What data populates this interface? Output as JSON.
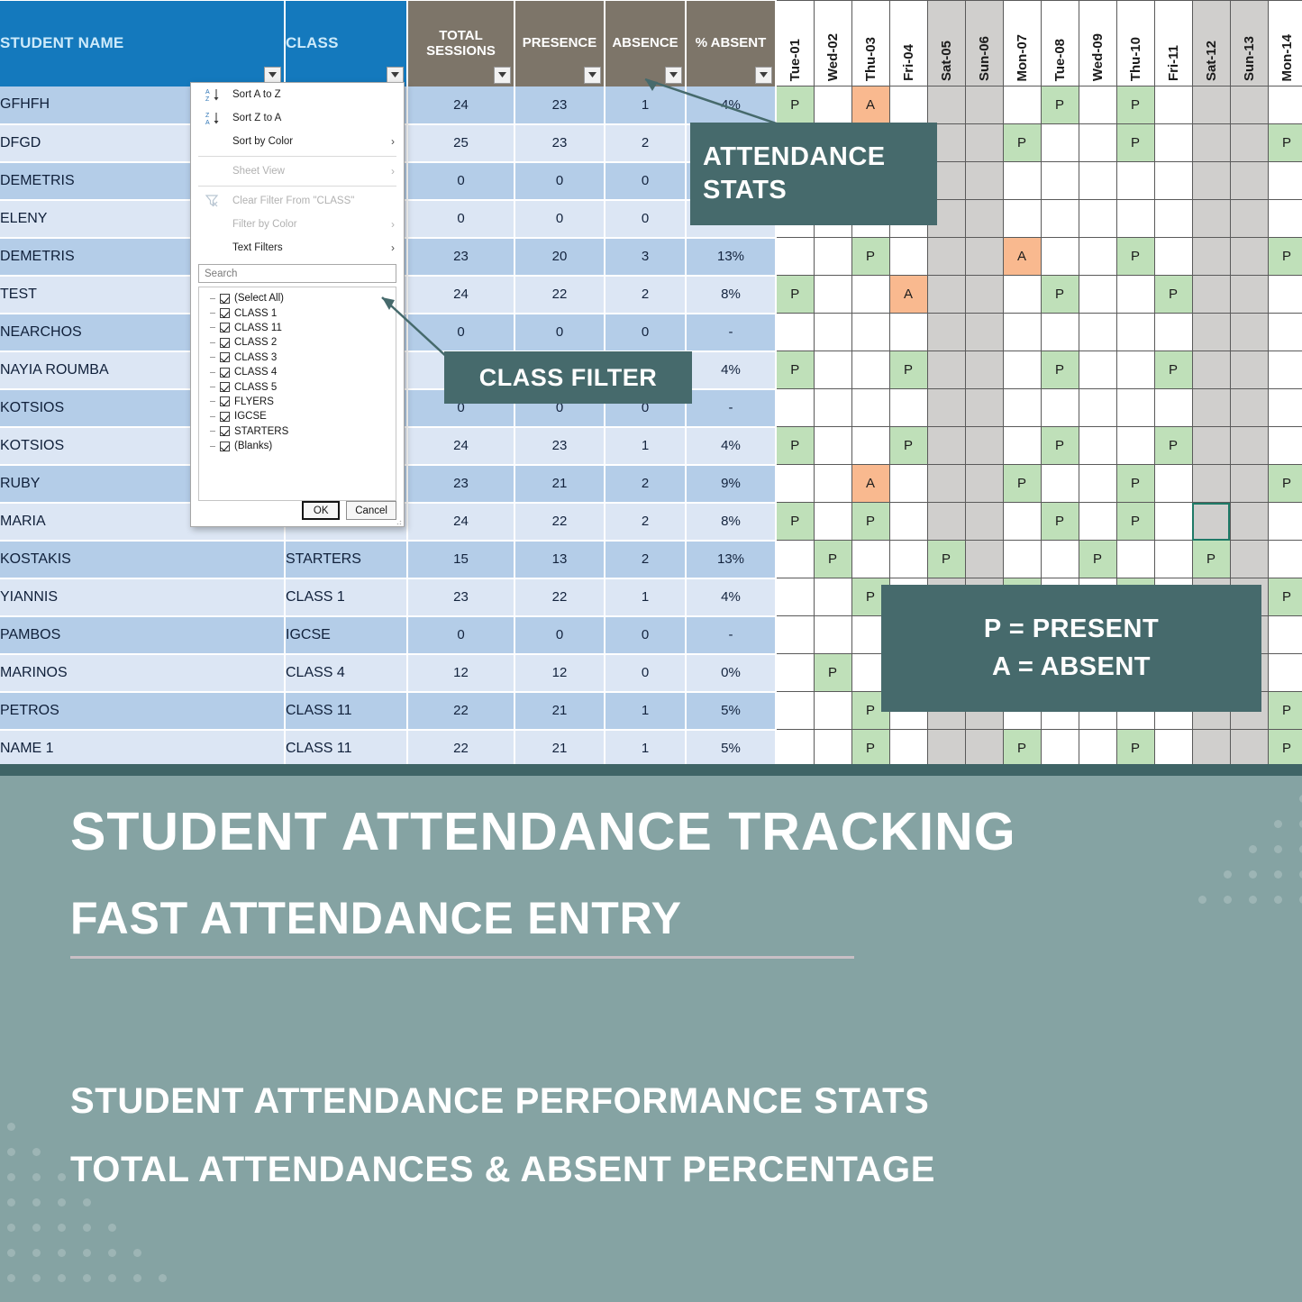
{
  "sheet": {
    "columns": {
      "student_name": "STUDENT NAME",
      "class": "CLASS",
      "total_sessions": "TOTAL SESSIONS",
      "total_sessions_l1": "TOTAL",
      "total_sessions_l2": "SESSIONS",
      "presence": "PRESENCE",
      "absence": "ABSENCE",
      "percent_absent": "% ABSENT"
    },
    "date_columns": [
      {
        "label": "Tue-01",
        "weekend": false
      },
      {
        "label": "Wed-02",
        "weekend": false
      },
      {
        "label": "Thu-03",
        "weekend": false
      },
      {
        "label": "Fri-04",
        "weekend": false
      },
      {
        "label": "Sat-05",
        "weekend": true
      },
      {
        "label": "Sun-06",
        "weekend": true
      },
      {
        "label": "Mon-07",
        "weekend": false
      },
      {
        "label": "Tue-08",
        "weekend": false
      },
      {
        "label": "Wed-09",
        "weekend": false
      },
      {
        "label": "Thu-10",
        "weekend": false
      },
      {
        "label": "Fri-11",
        "weekend": false
      },
      {
        "label": "Sat-12",
        "weekend": true
      },
      {
        "label": "Sun-13",
        "weekend": true
      },
      {
        "label": "Mon-14",
        "weekend": false
      }
    ],
    "rows": [
      {
        "name": "GFHFH",
        "class": "",
        "total": "24",
        "presence": "23",
        "absence": "1",
        "pct": "4%",
        "att": [
          "P",
          "",
          "A",
          "",
          "",
          "",
          "",
          "P",
          "",
          "P",
          "",
          "",
          "",
          ""
        ]
      },
      {
        "name": "DFGD",
        "class": "",
        "total": "25",
        "presence": "23",
        "absence": "2",
        "pct": "",
        "att": [
          "",
          "",
          "",
          "",
          "",
          "",
          "P",
          "",
          "",
          "P",
          "",
          "",
          "",
          "P"
        ]
      },
      {
        "name": "DEMETRIS",
        "class": "",
        "total": "0",
        "presence": "0",
        "absence": "0",
        "pct": "",
        "att": [
          "",
          "",
          "",
          "",
          "",
          "",
          "",
          "",
          "",
          "",
          "",
          "",
          "",
          ""
        ]
      },
      {
        "name": "ELENY",
        "class": "",
        "total": "0",
        "presence": "0",
        "absence": "0",
        "pct": "",
        "att": [
          "",
          "",
          "",
          "",
          "",
          "",
          "",
          "",
          "",
          "",
          "",
          "",
          "",
          ""
        ]
      },
      {
        "name": "DEMETRIS",
        "class": "",
        "total": "23",
        "presence": "20",
        "absence": "3",
        "pct": "13%",
        "att": [
          "",
          "",
          "P",
          "",
          "",
          "",
          "A",
          "",
          "",
          "P",
          "",
          "",
          "",
          "P"
        ]
      },
      {
        "name": "TEST",
        "class": "",
        "total": "24",
        "presence": "22",
        "absence": "2",
        "pct": "8%",
        "att": [
          "P",
          "",
          "",
          "A",
          "",
          "",
          "",
          "P",
          "",
          "",
          "P",
          "",
          "",
          ""
        ]
      },
      {
        "name": "NEARCHOS",
        "class": "",
        "total": "0",
        "presence": "0",
        "absence": "0",
        "pct": "-",
        "att": [
          "",
          "",
          "",
          "",
          "",
          "",
          "",
          "",
          "",
          "",
          "",
          "",
          "",
          ""
        ]
      },
      {
        "name": "NAYIA ROUMBA",
        "class": "",
        "total": "",
        "presence": "",
        "absence": "",
        "pct": "4%",
        "att": [
          "P",
          "",
          "",
          "P",
          "",
          "",
          "",
          "P",
          "",
          "",
          "P",
          "",
          "",
          ""
        ]
      },
      {
        "name": "KOTSIOS",
        "class": "",
        "total": "0",
        "presence": "0",
        "absence": "0",
        "pct": "-",
        "att": [
          "",
          "",
          "",
          "",
          "",
          "",
          "",
          "",
          "",
          "",
          "",
          "",
          "",
          ""
        ]
      },
      {
        "name": "KOTSIOS",
        "class": "",
        "total": "24",
        "presence": "23",
        "absence": "1",
        "pct": "4%",
        "att": [
          "P",
          "",
          "",
          "P",
          "",
          "",
          "",
          "P",
          "",
          "",
          "P",
          "",
          "",
          ""
        ]
      },
      {
        "name": "RUBY",
        "class": "",
        "total": "23",
        "presence": "21",
        "absence": "2",
        "pct": "9%",
        "att": [
          "",
          "",
          "A",
          "",
          "",
          "",
          "P",
          "",
          "",
          "P",
          "",
          "",
          "",
          "P"
        ]
      },
      {
        "name": "MARIA",
        "class": "",
        "total": "24",
        "presence": "22",
        "absence": "2",
        "pct": "8%",
        "att": [
          "P",
          "",
          "P",
          "",
          "",
          "",
          "",
          "P",
          "",
          "P",
          "",
          "SEL",
          "",
          ""
        ]
      },
      {
        "name": "KOSTAKIS",
        "class": "STARTERS",
        "total": "15",
        "presence": "13",
        "absence": "2",
        "pct": "13%",
        "att": [
          "",
          "P",
          "",
          "",
          "P",
          "",
          "",
          "",
          "P",
          "",
          "",
          "P",
          "",
          ""
        ]
      },
      {
        "name": "YIANNIS",
        "class": "CLASS 1",
        "total": "23",
        "presence": "22",
        "absence": "1",
        "pct": "4%",
        "att": [
          "",
          "",
          "P",
          "",
          "",
          "",
          "P",
          "",
          "",
          "P",
          "",
          "",
          "",
          "P"
        ]
      },
      {
        "name": "PAMBOS",
        "class": "IGCSE",
        "total": "0",
        "presence": "0",
        "absence": "0",
        "pct": "-",
        "att": [
          "",
          "",
          "",
          "",
          "",
          "",
          "",
          "",
          "",
          "",
          "",
          "",
          "",
          ""
        ]
      },
      {
        "name": "MARINOS",
        "class": "CLASS 4",
        "total": "12",
        "presence": "12",
        "absence": "0",
        "pct": "0%",
        "att": [
          "",
          "P",
          "",
          "",
          "",
          "",
          "",
          "",
          "",
          "",
          "",
          "",
          "",
          ""
        ]
      },
      {
        "name": "PETROS",
        "class": "CLASS 11",
        "total": "22",
        "presence": "21",
        "absence": "1",
        "pct": "5%",
        "att": [
          "",
          "",
          "P",
          "",
          "",
          "",
          "",
          "",
          "",
          "",
          "",
          "",
          "",
          "P"
        ]
      },
      {
        "name": "NAME 1",
        "class": "CLASS 11",
        "total": "22",
        "presence": "21",
        "absence": "1",
        "pct": "5%",
        "att": [
          "",
          "",
          "P",
          "",
          "",
          "",
          "P",
          "",
          "",
          "P",
          "",
          "",
          "",
          "P"
        ]
      }
    ]
  },
  "filter_menu": {
    "sort_a_z": "Sort A to Z",
    "sort_z_a": "Sort Z to A",
    "sort_by_color": "Sort by Color",
    "sheet_view": "Sheet View",
    "clear_filter": "Clear Filter From \"CLASS\"",
    "filter_by_color": "Filter by Color",
    "text_filters": "Text Filters",
    "search_placeholder": "Search",
    "options": [
      "(Select All)",
      "CLASS 1",
      "CLASS 11",
      "CLASS 2",
      "CLASS 3",
      "CLASS 4",
      "CLASS 5",
      "FLYERS",
      "IGCSE",
      "STARTERS",
      "(Blanks)"
    ],
    "ok": "OK",
    "cancel": "Cancel"
  },
  "callouts": {
    "attendance_stats_l1": "ATTENDANCE",
    "attendance_stats_l2": "STATS",
    "class_filter": "CLASS FILTER",
    "legend_present": "P = PRESENT",
    "legend_absent": "A = ABSENT"
  },
  "banner": {
    "title": "STUDENT ATTENDANCE TRACKING",
    "subtitle": "FAST ATTENDANCE ENTRY",
    "line1": "STUDENT ATTENDANCE PERFORMANCE STATS",
    "line2": "TOTAL ATTENDANCES & ABSENT PERCENTAGE"
  },
  "colors": {
    "header_blue": "#1479bd",
    "header_gray": "#7d7569",
    "band_a": "#b4cde8",
    "band_b": "#dce6f4",
    "present": "#bfe0b9",
    "absent": "#f9b98f",
    "weekend": "#d0cfcd",
    "callout": "#466a6c",
    "banner": "#85a3a3"
  }
}
